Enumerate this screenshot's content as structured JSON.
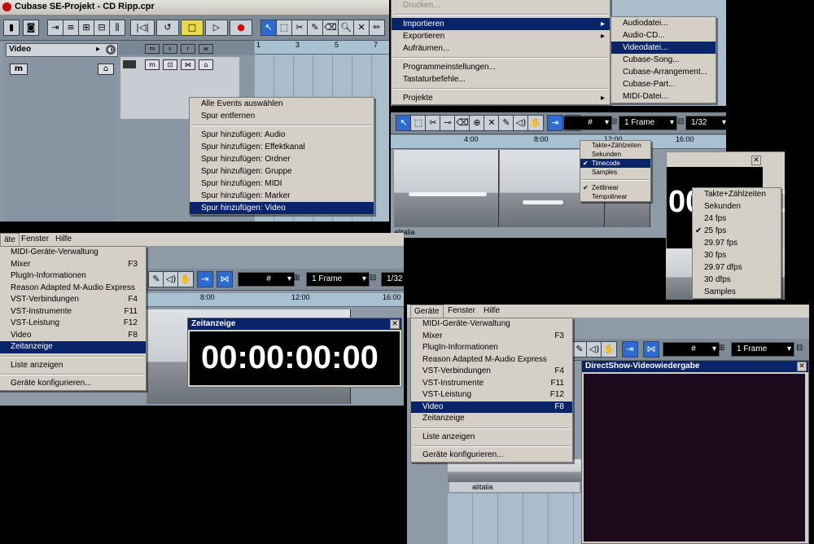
{
  "p1": {
    "title": "Cubase SE-Projekt - CD Ripp.cpr",
    "track_name": "Video",
    "track_m": "m",
    "ruler_ticks": [
      "1",
      "3",
      "5",
      "7"
    ],
    "ctx_menu": [
      {
        "label": "Alle Events auswählen"
      },
      {
        "label": "Spur entfernen"
      },
      {
        "sep": true
      },
      {
        "label": "Spur hinzufügen: Audio"
      },
      {
        "label": "Spur hinzufügen: Effektkanal"
      },
      {
        "label": "Spur hinzufügen: Ordner"
      },
      {
        "label": "Spur hinzufügen: Gruppe"
      },
      {
        "label": "Spur hinzufügen: MIDI"
      },
      {
        "label": "Spur hinzufügen: Marker"
      },
      {
        "label": "Spur hinzufügen: Video",
        "selected": true
      }
    ]
  },
  "p2": {
    "menu": [
      {
        "label": "Drucken...",
        "disabled": true
      },
      {
        "sep": true
      },
      {
        "label": "Importieren",
        "submenu": true,
        "selected": true
      },
      {
        "label": "Exportieren",
        "submenu": true
      },
      {
        "label": "Aufräumen..."
      },
      {
        "sep": true
      },
      {
        "label": "Programmeinstellungen..."
      },
      {
        "label": "Tastaturbefehle..."
      },
      {
        "sep": true
      },
      {
        "label": "Projekte",
        "submenu": true
      }
    ],
    "submenu": [
      {
        "label": "Audiodatei..."
      },
      {
        "label": "Audio-CD..."
      },
      {
        "label": "Videodatei...",
        "selected": true
      },
      {
        "label": "Cubase-Song..."
      },
      {
        "label": "Cubase-Arrangement..."
      },
      {
        "label": "Cubase-Part..."
      },
      {
        "label": "MIDI-Datei..."
      }
    ]
  },
  "p3": {
    "frame_combo": "1 Frame",
    "quant_combo": "1/32",
    "ruler_ticks": [
      "4:00",
      "8:00",
      "12:00",
      "16:00"
    ],
    "track_label": "alitalia",
    "format_menu": [
      {
        "label": "Takte+Zählzeiten"
      },
      {
        "label": "Sekunden"
      },
      {
        "label": "Timecode",
        "checked": true,
        "selected": true
      },
      {
        "label": "Samples"
      },
      {
        "sep": true
      },
      {
        "label": "Zeitlinear",
        "checked": true
      },
      {
        "label": "Tempolinear"
      }
    ]
  },
  "p4": {
    "display_text": "00:00:00",
    "fps_menu": [
      {
        "label": "Takte+Zählzeiten"
      },
      {
        "label": "Sekunden"
      },
      {
        "label": "24 fps"
      },
      {
        "label": "25 fps",
        "checked": true
      },
      {
        "label": "29.97 fps"
      },
      {
        "label": "30 fps"
      },
      {
        "label": "29.97 dfps"
      },
      {
        "label": "30 dfps"
      },
      {
        "label": "Samples"
      }
    ]
  },
  "p5": {
    "menubar": [
      "äte",
      "Fenster",
      "Hilfe"
    ],
    "frame_combo": "1 Frame",
    "quant_combo": "1/32",
    "ruler_ticks": [
      "8:00",
      "12:00",
      "16:00"
    ],
    "menu": [
      {
        "label": "MIDI-Geräte-Verwaltung"
      },
      {
        "label": "Mixer",
        "shortcut": "F3"
      },
      {
        "label": "PlugIn-Informationen"
      },
      {
        "label": "Reason Adapted M-Audio Express"
      },
      {
        "label": "VST-Verbindungen",
        "shortcut": "F4"
      },
      {
        "label": "VST-Instrumente",
        "shortcut": "F11"
      },
      {
        "label": "VST-Leistung",
        "shortcut": "F12"
      },
      {
        "label": "Video",
        "shortcut": "F8"
      },
      {
        "label": "Zeitanzeige",
        "selected": true
      },
      {
        "sep": true
      },
      {
        "label": "Liste anzeigen"
      },
      {
        "sep": true
      },
      {
        "label": "Geräte konfigurieren..."
      }
    ],
    "zeit_title": "Zeitanzeige",
    "zeit_value": "00:00:00:00"
  },
  "p6": {
    "menubar": [
      "Geräte",
      "Fenster",
      "Hilfe"
    ],
    "frame_combo": "1 Frame",
    "menu": [
      {
        "label": "MIDI-Geräte-Verwaltung"
      },
      {
        "label": "Mixer",
        "shortcut": "F3"
      },
      {
        "label": "PlugIn-Informationen"
      },
      {
        "label": "Reason Adapted M-Audio Express"
      },
      {
        "label": "VST-Verbindungen",
        "shortcut": "F4"
      },
      {
        "label": "VST-Instrumente",
        "shortcut": "F11"
      },
      {
        "label": "VST-Leistung",
        "shortcut": "F12"
      },
      {
        "label": "Video",
        "shortcut": "F8",
        "selected": true
      },
      {
        "label": "Zeitanzeige"
      },
      {
        "sep": true
      },
      {
        "label": "Liste anzeigen"
      },
      {
        "sep": true
      },
      {
        "label": "Geräte konfigurieren..."
      }
    ],
    "ds_title": "DirectShow-Videowiedergabe",
    "track_label": "alitalia"
  }
}
